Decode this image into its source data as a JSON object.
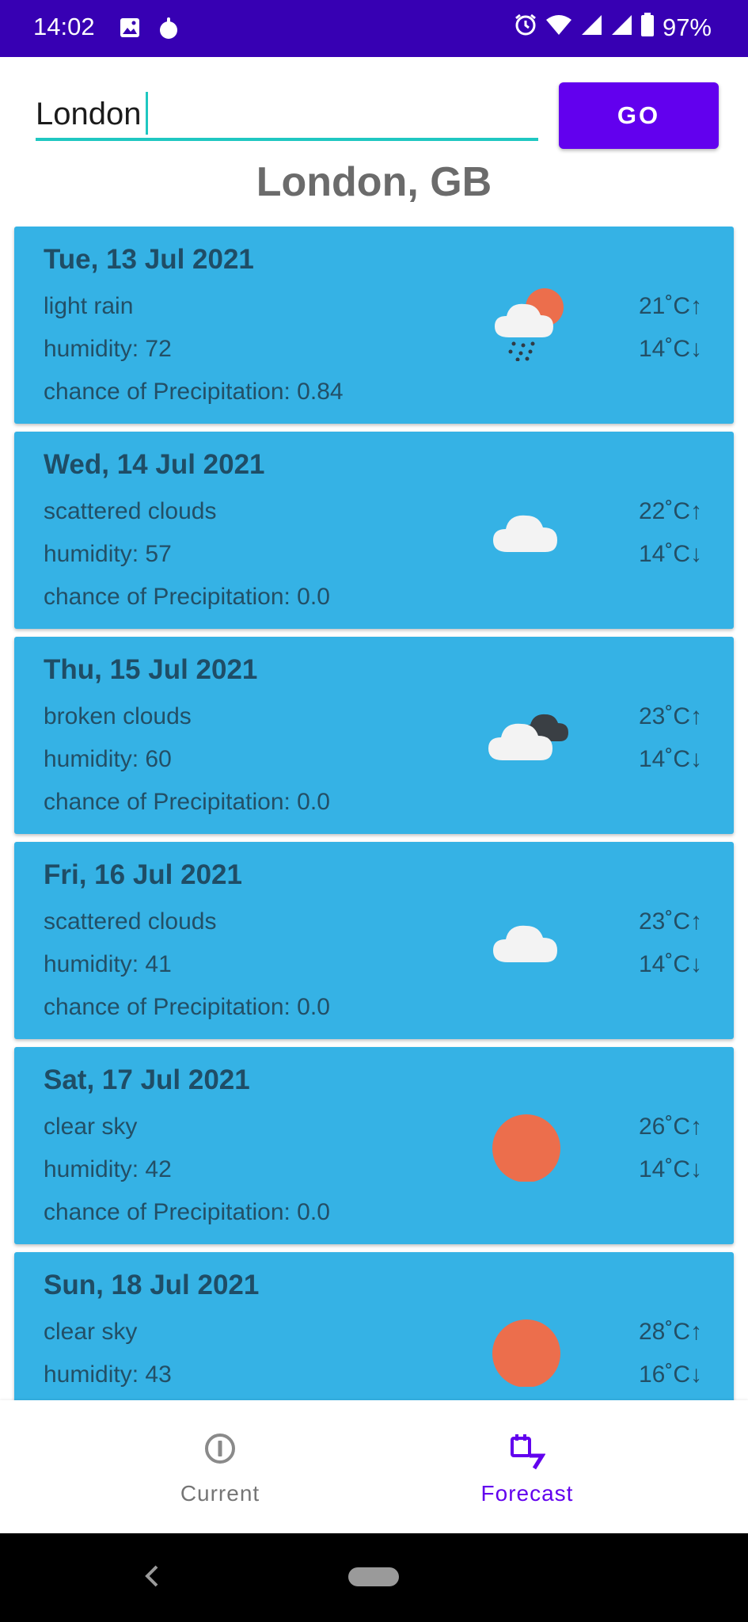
{
  "status_bar": {
    "time": "14:02",
    "battery": "97%",
    "icons": [
      "image-icon",
      "app-notification-icon",
      "alarm-icon",
      "wifi-icon",
      "signal-icon",
      "signal-icon",
      "battery-icon"
    ]
  },
  "search": {
    "value": "London",
    "go_label": "GO"
  },
  "city": "London, GB",
  "forecast": [
    {
      "date": "Tue, 13 Jul 2021",
      "desc": "light rain",
      "humidity": "humidity: 72",
      "precip": "chance of Precipitation: 0.84",
      "max": "21˚C↑",
      "min": "14˚C↓",
      "icon": "light-rain-icon"
    },
    {
      "date": "Wed, 14 Jul 2021",
      "desc": "scattered clouds",
      "humidity": "humidity: 57",
      "precip": "chance of Precipitation: 0.0",
      "max": "22˚C↑",
      "min": "14˚C↓",
      "icon": "cloud-icon"
    },
    {
      "date": "Thu, 15 Jul 2021",
      "desc": "broken clouds",
      "humidity": "humidity: 60",
      "precip": "chance of Precipitation: 0.0",
      "max": "23˚C↑",
      "min": "14˚C↓",
      "icon": "broken-clouds-icon"
    },
    {
      "date": "Fri, 16 Jul 2021",
      "desc": "scattered clouds",
      "humidity": "humidity: 41",
      "precip": "chance of Precipitation: 0.0",
      "max": "23˚C↑",
      "min": "14˚C↓",
      "icon": "cloud-icon"
    },
    {
      "date": "Sat, 17 Jul 2021",
      "desc": "clear sky",
      "humidity": "humidity: 42",
      "precip": "chance of Precipitation: 0.0",
      "max": "26˚C↑",
      "min": "14˚C↓",
      "icon": "sun-icon"
    },
    {
      "date": "Sun, 18 Jul 2021",
      "desc": "clear sky",
      "humidity": "humidity: 43",
      "precip": "",
      "max": "28˚C↑",
      "min": "16˚C↓",
      "icon": "sun-icon"
    }
  ],
  "bottom_nav": {
    "current_label": "Current",
    "forecast_label": "Forecast",
    "active": "Forecast"
  },
  "colors": {
    "status_bar": "#3700b3",
    "primary": "#6200ee",
    "accent": "#1fc7c1",
    "card": "#35b2e5",
    "card_text": "#234f66",
    "sun": "#ec6e4c"
  }
}
